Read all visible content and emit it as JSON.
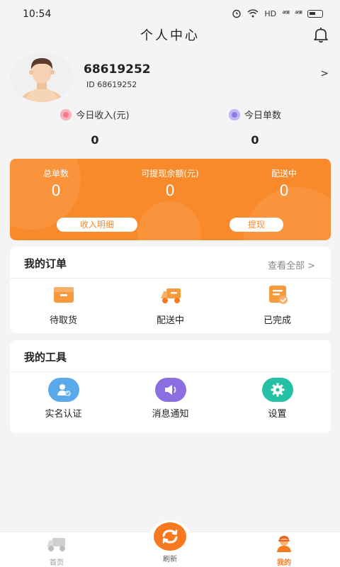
{
  "status": {
    "time": "10:54",
    "hd": "HD",
    "signal1": "⁴⁶ᴵᴵᴵ",
    "signal2": "⁴⁶ᴵᴵᴵ"
  },
  "header": {
    "title": "个人中心"
  },
  "profile": {
    "name": "68619252",
    "id_text": "ID 68619252",
    "arrow": ">"
  },
  "today": {
    "income_label": "今日收入(元)",
    "income_value": "0",
    "orders_label": "今日单数",
    "orders_value": "0"
  },
  "summary": {
    "total_label": "总单数",
    "total_value": "0",
    "withdrawable_label": "可提现余额(元)",
    "withdrawable_value": "0",
    "delivering_label": "配送中",
    "delivering_value": "0",
    "income_detail_button": "收入明细",
    "withdraw_button": "提现"
  },
  "orders": {
    "title": "我的订单",
    "view_all": "查看全部 >",
    "items": [
      {
        "label": "待取货"
      },
      {
        "label": "配送中"
      },
      {
        "label": "已完成"
      }
    ]
  },
  "tools": {
    "title": "我的工具",
    "items": [
      {
        "label": "实名认证"
      },
      {
        "label": "消息通知"
      },
      {
        "label": "设置"
      }
    ]
  },
  "tabbar": {
    "home": "首页",
    "refresh": "刷新",
    "mine": "我的"
  },
  "colors": {
    "accent": "#f98a2c",
    "accent_dark": "#f6791f",
    "background": "#f4f4f6"
  }
}
